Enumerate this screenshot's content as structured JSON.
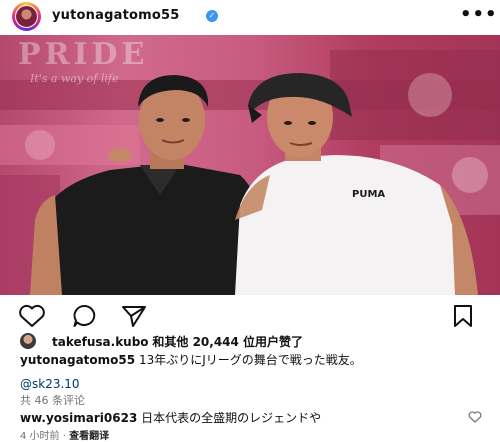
{
  "header": {
    "username": "yutonagatomo55",
    "verified_icon": "verified-badge-icon",
    "more_label": "•••"
  },
  "photo": {
    "banner_title": "PRIDE",
    "banner_subtitle": "It's a way of life",
    "shirt_brand": "PUMA",
    "colors": {
      "background": "#c85c80",
      "dark_shirt": "#1b1b1b",
      "white_shirt": "#f4f2f2"
    }
  },
  "actions": {
    "like_icon": "heart-icon",
    "comment_icon": "comment-icon",
    "share_icon": "share-icon",
    "save_icon": "bookmark-icon"
  },
  "likes": {
    "user": "takefusa.kubo",
    "text": "和其他 20,444 位用户赞了"
  },
  "caption": {
    "username": "yutonagatomo55",
    "text": "13年ぶりにJリーグの舞台で戦った戦友。"
  },
  "mention": "@sk23.10",
  "comments_count": "共 46 条评论",
  "top_comment": {
    "username": "ww.yosimari0623",
    "text": "日本代表の全盛期のレジェンドや"
  },
  "meta": {
    "time": "4 小时前",
    "separator": "·",
    "translate": "查看翻译"
  }
}
